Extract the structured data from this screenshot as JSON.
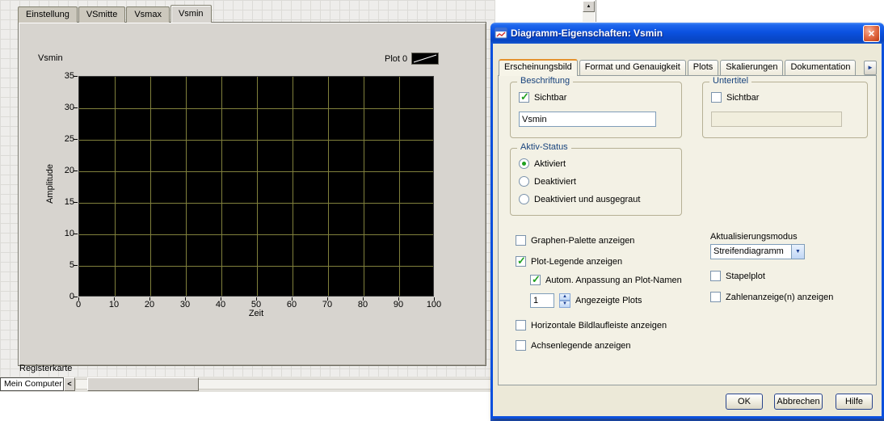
{
  "window": {
    "left_tabs": [
      {
        "label": "Einstellung",
        "selected": false
      },
      {
        "label": "VSmitte",
        "selected": false
      },
      {
        "label": "Vsmax",
        "selected": false
      },
      {
        "label": "Vsmin",
        "selected": true
      }
    ],
    "registerkarte_label": "Registerkarte",
    "mein_computer_label": "Mein Computer"
  },
  "chart_data": {
    "type": "line",
    "title": "Vsmin",
    "legend": [
      "Plot 0"
    ],
    "xlabel": "Zeit",
    "ylabel": "Amplitude",
    "xlim": [
      0,
      100
    ],
    "ylim": [
      0,
      35
    ],
    "x_ticks": [
      0,
      10,
      20,
      30,
      40,
      50,
      60,
      70,
      80,
      90,
      100
    ],
    "y_ticks": [
      0,
      5,
      10,
      15,
      20,
      25,
      30,
      35
    ],
    "series": [
      {
        "name": "Plot 0",
        "values": []
      }
    ],
    "grid": true,
    "plot_bg": "#000000",
    "grid_color": "#80803c"
  },
  "dialog": {
    "title": "Diagramm-Eigenschaften: Vsmin",
    "tabs": [
      {
        "label": "Erscheinungsbild",
        "selected": true
      },
      {
        "label": "Format und Genauigkeit",
        "selected": false
      },
      {
        "label": "Plots",
        "selected": false
      },
      {
        "label": "Skalierungen",
        "selected": false
      },
      {
        "label": "Dokumentation",
        "selected": false
      }
    ],
    "beschriftung": {
      "legend": "Beschriftung",
      "checkbox": "Sichtbar",
      "checked": true,
      "value": "Vsmin"
    },
    "untertitel": {
      "legend": "Untertitel",
      "checkbox": "Sichtbar",
      "checked": false,
      "value": ""
    },
    "aktiv_status": {
      "legend": "Aktiv-Status",
      "options": [
        {
          "label": "Aktiviert",
          "selected": true
        },
        {
          "label": "Deaktiviert",
          "selected": false
        },
        {
          "label": "Deaktiviert und ausgegraut",
          "selected": false
        }
      ]
    },
    "options": {
      "graphen_palette": {
        "label": "Graphen-Palette anzeigen",
        "checked": false
      },
      "plot_legende": {
        "label": "Plot-Legende anzeigen",
        "checked": true
      },
      "autom_anpassung": {
        "label": "Autom. Anpassung an Plot-Namen",
        "checked": true
      },
      "angezeigte_plots": {
        "value": "1",
        "label": "Angezeigte Plots"
      },
      "horizontale_bildlaufleiste": {
        "label": "Horizontale Bildlaufleiste anzeigen",
        "checked": false
      },
      "achsenlegende": {
        "label": "Achsenlegende anzeigen",
        "checked": false
      },
      "aktualisierungsmodus": {
        "label": "Aktualisierungsmodus",
        "value": "Streifendiagramm"
      },
      "stapelplot": {
        "label": "Stapelplot",
        "checked": false
      },
      "zahlenanzeige": {
        "label": "Zahlenanzeige(n) anzeigen",
        "checked": false
      }
    },
    "buttons": {
      "ok": "OK",
      "cancel": "Abbrechen",
      "help": "Hilfe"
    }
  },
  "icons": {
    "close": "×",
    "scroll_up": "▲",
    "combo_arrow": "▼",
    "spin_up": "▲",
    "spin_down": "▼",
    "tab_scroll_right": "►",
    "mc_arrow": "<"
  },
  "colors": {
    "titlebar_blue": "#0b50e0",
    "check_green": "#21a121",
    "plot_bg": "#000000",
    "grid_color": "#80803c"
  }
}
